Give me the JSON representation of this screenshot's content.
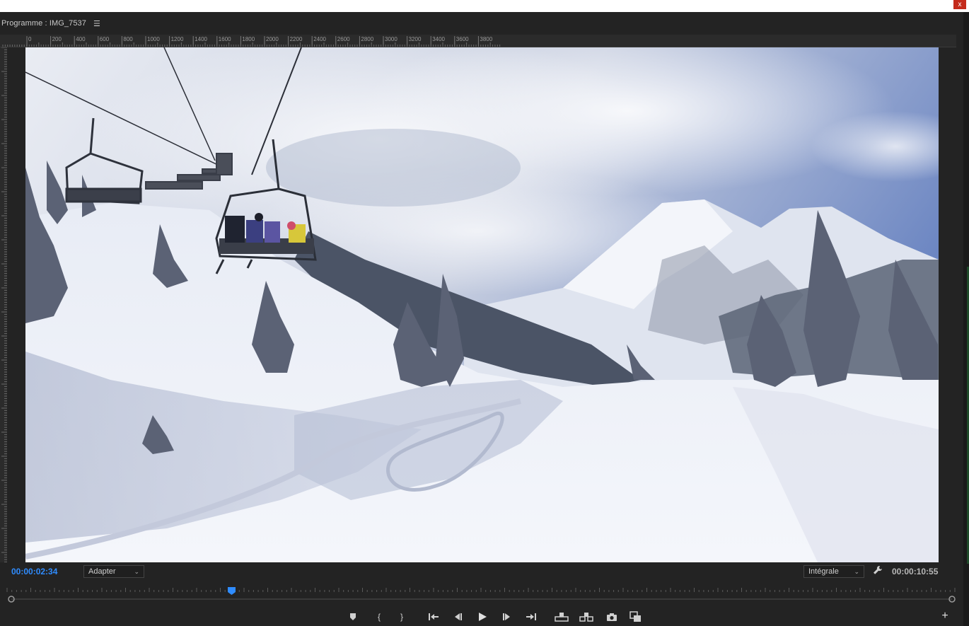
{
  "window": {
    "close_label": "x"
  },
  "panel": {
    "title": "Programme : IMG_7537",
    "menu_icon": "hamburger-icon"
  },
  "ruler": {
    "labels": [
      "0",
      "200",
      "400",
      "600",
      "800",
      "1000",
      "1200",
      "1400",
      "1600",
      "1800",
      "2000",
      "2200",
      "2400",
      "2600",
      "2800",
      "3000",
      "3200",
      "3400",
      "3600",
      "3800"
    ]
  },
  "controls": {
    "timecode_current": "00:00:02:34",
    "zoom_dropdown": "Adapter",
    "resolution_dropdown": "Intégrale",
    "timecode_total": "00:00:10:55",
    "settings_icon": "wrench-icon",
    "playhead_progress": 0.234
  },
  "transport": {
    "buttons": [
      {
        "name": "add-marker-button",
        "icon": "marker-icon"
      },
      {
        "name": "mark-in-button",
        "icon": "mark-in-icon"
      },
      {
        "name": "mark-out-button",
        "icon": "mark-out-icon"
      },
      {
        "name": "go-to-in-button",
        "icon": "go-to-in-icon"
      },
      {
        "name": "step-back-button",
        "icon": "step-back-icon"
      },
      {
        "name": "play-button",
        "icon": "play-icon"
      },
      {
        "name": "step-forward-button",
        "icon": "step-forward-icon"
      },
      {
        "name": "go-to-out-button",
        "icon": "go-to-out-icon"
      },
      {
        "name": "lift-button",
        "icon": "lift-icon"
      },
      {
        "name": "extract-button",
        "icon": "extract-icon"
      },
      {
        "name": "export-frame-button",
        "icon": "camera-icon"
      },
      {
        "name": "compare-view-button",
        "icon": "compare-icon"
      }
    ],
    "add_label": "+"
  }
}
